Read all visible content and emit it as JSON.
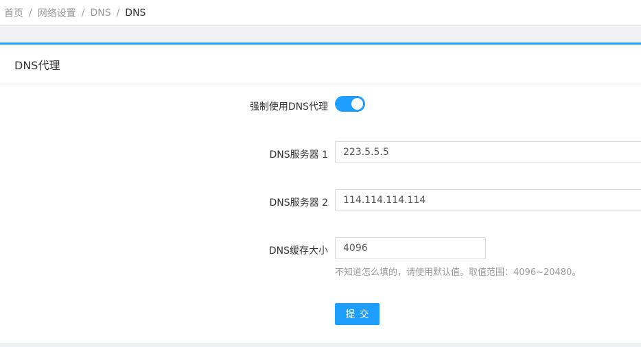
{
  "breadcrumb": {
    "items": [
      "首页",
      "网络设置",
      "DNS",
      "DNS"
    ],
    "separator": "/"
  },
  "card": {
    "title": "DNS代理"
  },
  "form": {
    "force_proxy": {
      "label": "强制使用DNS代理",
      "enabled": true
    },
    "server1": {
      "label": "DNS服务器 1",
      "value": "223.5.5.5"
    },
    "server2": {
      "label": "DNS服务器 2",
      "value": "114.114.114.114"
    },
    "cache": {
      "label": "DNS缓存大小",
      "value": "4096",
      "hint": "不知道怎么填的，请使用默认值。取值范围：4096~20480。"
    },
    "submit_label": "提交"
  },
  "colors": {
    "accent": "#1e9fff"
  }
}
